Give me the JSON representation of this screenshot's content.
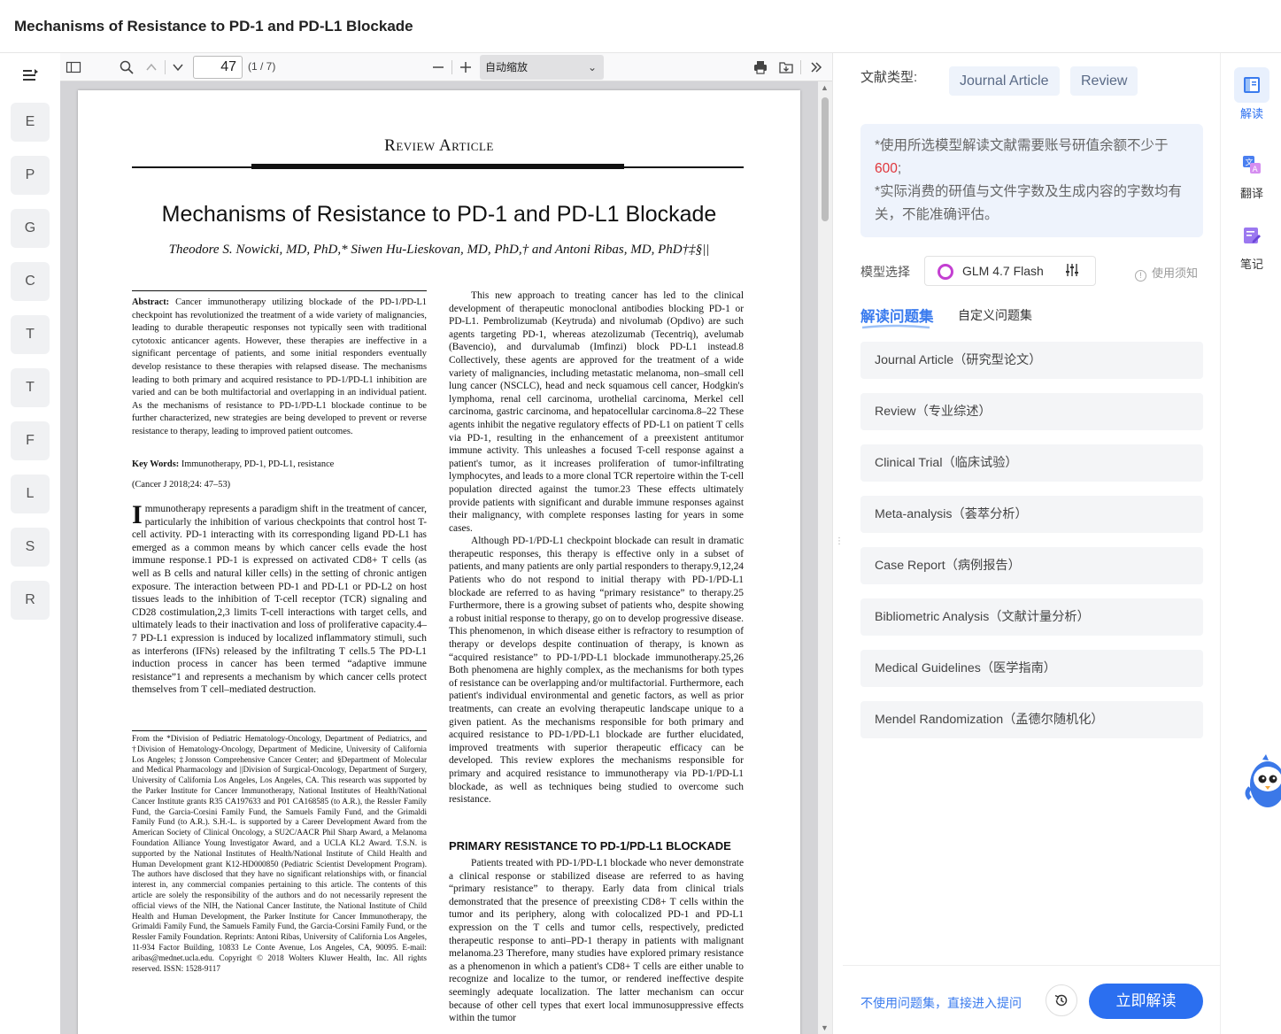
{
  "window": {
    "title": "Mechanisms of Resistance to PD-1 and PD-L1 Blockade"
  },
  "outline": {
    "letters": [
      "E",
      "P",
      "G",
      "C",
      "T",
      "T",
      "F",
      "L",
      "S",
      "R"
    ]
  },
  "pdf_toolbar": {
    "page_current": "47",
    "page_count": "(1 / 7)",
    "zoom": "自动缩放",
    "icons": [
      "sidebar-toggle-icon",
      "search-icon",
      "chevron-up-icon",
      "chevron-down-icon",
      "zoom-out-icon",
      "zoom-in-icon",
      "print-icon",
      "download-icon",
      "more-tools-icon"
    ]
  },
  "document": {
    "section_label": "Review Article",
    "title": "Mechanisms of Resistance to PD-1 and PD-L1 Blockade",
    "authors": "Theodore S. Nowicki, MD, PhD,* Siwen Hu-Lieskovan, MD, PhD,† and Antoni Ribas, MD, PhD†‡§||",
    "abstract_label": "Abstract:",
    "abstract_text": "Cancer immunotherapy utilizing blockade of the PD-1/PD-L1 checkpoint has revolutionized the treatment of a wide variety of malignancies, leading to durable therapeutic responses not typically seen with traditional cytotoxic anticancer agents. However, these therapies are ineffective in a significant percentage of patients, and some initial responders eventually develop resistance to these therapies with relapsed disease. The mechanisms leading to both primary and acquired resistance to PD-1/PD-L1 inhibition are varied and can be both multifactorial and overlapping in an individual patient. As the mechanisms of resistance to PD-1/PD-L1 blockade continue to be further characterized, new strategies are being developed to prevent or reverse resistance to therapy, leading to improved patient outcomes.",
    "keywords_label": "Key Words:",
    "keywords_text": "Immunotherapy, PD-1, PD-L1, resistance",
    "citation": "(Cancer J 2018;24: 47–53)",
    "intro_dropcap": "I",
    "intro_text": "mmunotherapy represents a paradigm shift in the treatment of cancer, particularly the inhibition of various checkpoints that control host T-cell activity. PD-1 interacting with its corresponding ligand PD-L1 has emerged as a common means by which cancer cells evade the host immune response.1 PD-1 is expressed on activated CD8+ T cells (as well as B cells and natural killer cells) in the setting of chronic antigen exposure. The interaction between PD-1 and PD-L1 or PD-L2 on host tissues leads to the inhibition of T-cell receptor (TCR) signaling and CD28 costimulation,2,3 limits T-cell interactions with target cells, and ultimately leads to their inactivation and loss of proliferative capacity.4–7 PD-L1 expression is induced by localized inflammatory stimuli, such as interferons (IFNs) released by the infiltrating T cells.5 The PD-L1 induction process in cancer has been termed “adaptive immune resistance”1 and represents a mechanism by which cancer cells protect themselves from T cell–mediated destruction.",
    "footnote": "From the *Division of Pediatric Hematology-Oncology, Department of Pediatrics, and †Division of Hematology-Oncology, Department of Medicine, University of California Los Angeles; ‡Jonsson Comprehensive Cancer Center; and §Department of Molecular and Medical Pharmacology and ||Division of Surgical-Oncology, Department of Surgery, University of California Los Angeles, Los Angeles, CA. This research was supported by the Parker Institute for Cancer Immunotherapy, National Institutes of Health/National Cancer Institute grants R35 CA197633 and P01 CA168585 (to A.R.), the Ressler Family Fund, the Garcia-Corsini Family Fund, the Samuels Family Fund, and the Grimaldi Family Fund (to A.R.). S.H.-L. is supported by a Career Development Award from the American Society of Clinical Oncology, a SU2C/AACR Phil Sharp Award, a Melanoma Foundation Alliance Young Investigator Award, and a UCLA KL2 Award. T.S.N. is supported by the National Institutes of Health/National Institute of Child Health and Human Development grant K12-HD000850 (Pediatric Scientist Development Program). The authors have disclosed that they have no significant relationships with, or financial interest in, any commercial companies pertaining to this article. The contents of this article are solely the responsibility of the authors and do not necessarily represent the official views of the NIH, the National Cancer Institute, the National Institute of Child Health and Human Development, the Parker Institute for Cancer Immunotherapy, the Grimaldi Family Fund, the Samuels Family Fund, the Garcia-Corsini Family Fund, or the Ressler Family Foundation. Reprints: Antoni Ribas, University of California Los Angeles, 11-934 Factor Building, 10833 Le Conte Avenue, Los Angeles, CA, 90095. E-mail: aribas@mednet.ucla.edu. Copyright © 2018 Wolters Kluwer Health, Inc. All rights reserved. ISSN: 1528-9117",
    "right_p1": "This new approach to treating cancer has led to the clinical development of therapeutic monoclonal antibodies blocking PD-1 or PD-L1. Pembrolizumab (Keytruda) and nivolumab (Opdivo) are such agents targeting PD-1, whereas atezolizumab (Tecentriq), avelumab (Bavencio), and durvalumab (Imfinzi) block PD-L1 instead.8 Collectively, these agents are approved for the treatment of a wide variety of malignancies, including metastatic melanoma, non–small cell lung cancer (NSCLC), head and neck squamous cell cancer, Hodgkin's lymphoma, renal cell carcinoma, urothelial carcinoma, Merkel cell carcinoma, gastric carcinoma, and hepatocellular carcinoma.8–22 These agents inhibit the negative regulatory effects of PD-L1 on patient T cells via PD-1, resulting in the enhancement of a preexistent antitumor immune activity. This unleashes a focused T-cell response against a patient's tumor, as it increases proliferation of tumor-infiltrating lymphocytes, and leads to a more clonal TCR repertoire within the T-cell population directed against the tumor.23 These effects ultimately provide patients with significant and durable immune responses against their malignancy, with complete responses lasting for years in some cases.",
    "right_p2": "Although PD-1/PD-L1 checkpoint blockade can result in dramatic therapeutic responses, this therapy is effective only in a subset of patients, and many patients are only partial responders to therapy.9,12,24 Patients who do not respond to initial therapy with PD-1/PD-L1 blockade are referred to as having “primary resistance” to therapy.25 Furthermore, there is a growing subset of patients who, despite showing a robust initial response to therapy, go on to develop progressive disease. This phenomenon, in which disease either is refractory to resumption of therapy or develops despite continuation of therapy, is known as “acquired resistance” to PD-1/PD-L1 blockade immunotherapy.25,26 Both phenomena are highly complex, as the mechanisms for both types of resistance can be overlapping and/or multifactorial. Furthermore, each patient's individual environmental and genetic factors, as well as prior treatments, can create an evolving therapeutic landscape unique to a given patient. As the mechanisms responsible for both primary and acquired resistance to PD-1/PD-L1 blockade are further elucidated, improved treatments with superior therapeutic efficacy can be developed. This review explores the mechanisms responsible for primary and acquired resistance to immunotherapy via PD-1/PD-L1 blockade, as well as techniques being studied to overcome such resistance.",
    "heading2": "PRIMARY RESISTANCE TO PD-1/PD-L1 BLOCKADE",
    "right_p3": "Patients treated with PD-1/PD-L1 blockade who never demonstrate a clinical response or stabilized disease are referred to as having “primary resistance” to therapy. Early data from clinical trials demonstrated that the presence of preexisting CD8+ T cells within the tumor and its periphery, along with colocalized PD-1 and PD-L1 expression on the T cells and tumor cells, respectively, predicted therapeutic response to anti–PD-1 therapy in patients with malignant melanoma.23 Therefore, many studies have explored primary resistance as a phenomenon in which a patient's CD8+ T cells are either unable to recognize and localize to the tumor, or rendered ineffective despite seemingly adequate localization. The latter mechanism can occur because of other cell types that exert local immunosuppressive effects within the tumor"
  },
  "panel": {
    "doctype_label": "文献类型:",
    "doctype_chips": [
      "Journal Article",
      "Review"
    ],
    "notice_line1": "*使用所选模型解读文献需要账号研值余额不少于",
    "notice_amount": "600",
    "notice_sep": ";",
    "notice_line2": "*实际消费的研值与文件字数及生成内容的字数均有关，不能准确评估。",
    "model_label": "模型选择",
    "model_name": "GLM 4.7 Flash",
    "usage_note": "使用须知",
    "tab_active": "解读问题集",
    "tab_custom": "自定义问题集",
    "questions": [
      "Journal Article（研究型论文）",
      "Review（专业综述）",
      "Clinical Trial（临床试验）",
      "Meta-analysis（荟萃分析）",
      "Case Report（病例报告）",
      "Bibliometric Analysis（文献计量分析）",
      "Medical Guidelines（医学指南）",
      "Mendel Randomization（孟德尔随机化）"
    ],
    "skip_link": "不使用问题集，直接进入提问",
    "start_button": "立即解读"
  },
  "sidebar": {
    "items": [
      "解读",
      "翻译",
      "笔记"
    ]
  },
  "colors": {
    "accent": "#2b6ff0",
    "warning": "#e0353b"
  }
}
